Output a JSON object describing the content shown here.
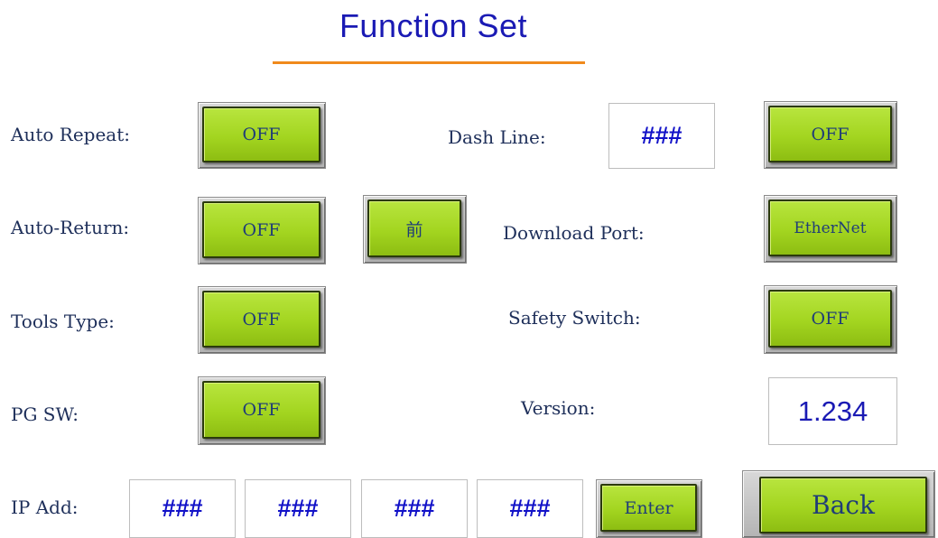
{
  "header": {
    "title": "Function Set"
  },
  "settings": {
    "auto_repeat": {
      "label": "Auto Repeat:",
      "value": "OFF"
    },
    "auto_return": {
      "label": "Auto-Return:",
      "value": "OFF",
      "extra_button": "前"
    },
    "tools_type": {
      "label": "Tools Type:",
      "value": "OFF"
    },
    "pg_sw": {
      "label": "PG SW:",
      "value": "OFF"
    },
    "dash_line": {
      "label": "Dash Line:",
      "field_value": "###",
      "value": "OFF"
    },
    "download_port": {
      "label": "Download Port:",
      "value": "EtherNet"
    },
    "safety_switch": {
      "label": "Safety Switch:",
      "value": "OFF"
    },
    "version": {
      "label": "Version:",
      "value": "1.234"
    }
  },
  "ip": {
    "label": "IP Add:",
    "octets": [
      "###",
      "###",
      "###",
      "###"
    ],
    "enter_label": "Enter"
  },
  "footer": {
    "back_label": "Back"
  },
  "colors": {
    "title": "#1a1ab4",
    "title_rule": "#f08a1c",
    "key_green": "#a3d520",
    "key_text": "#1f3d78",
    "field_text": "#1212c8"
  }
}
